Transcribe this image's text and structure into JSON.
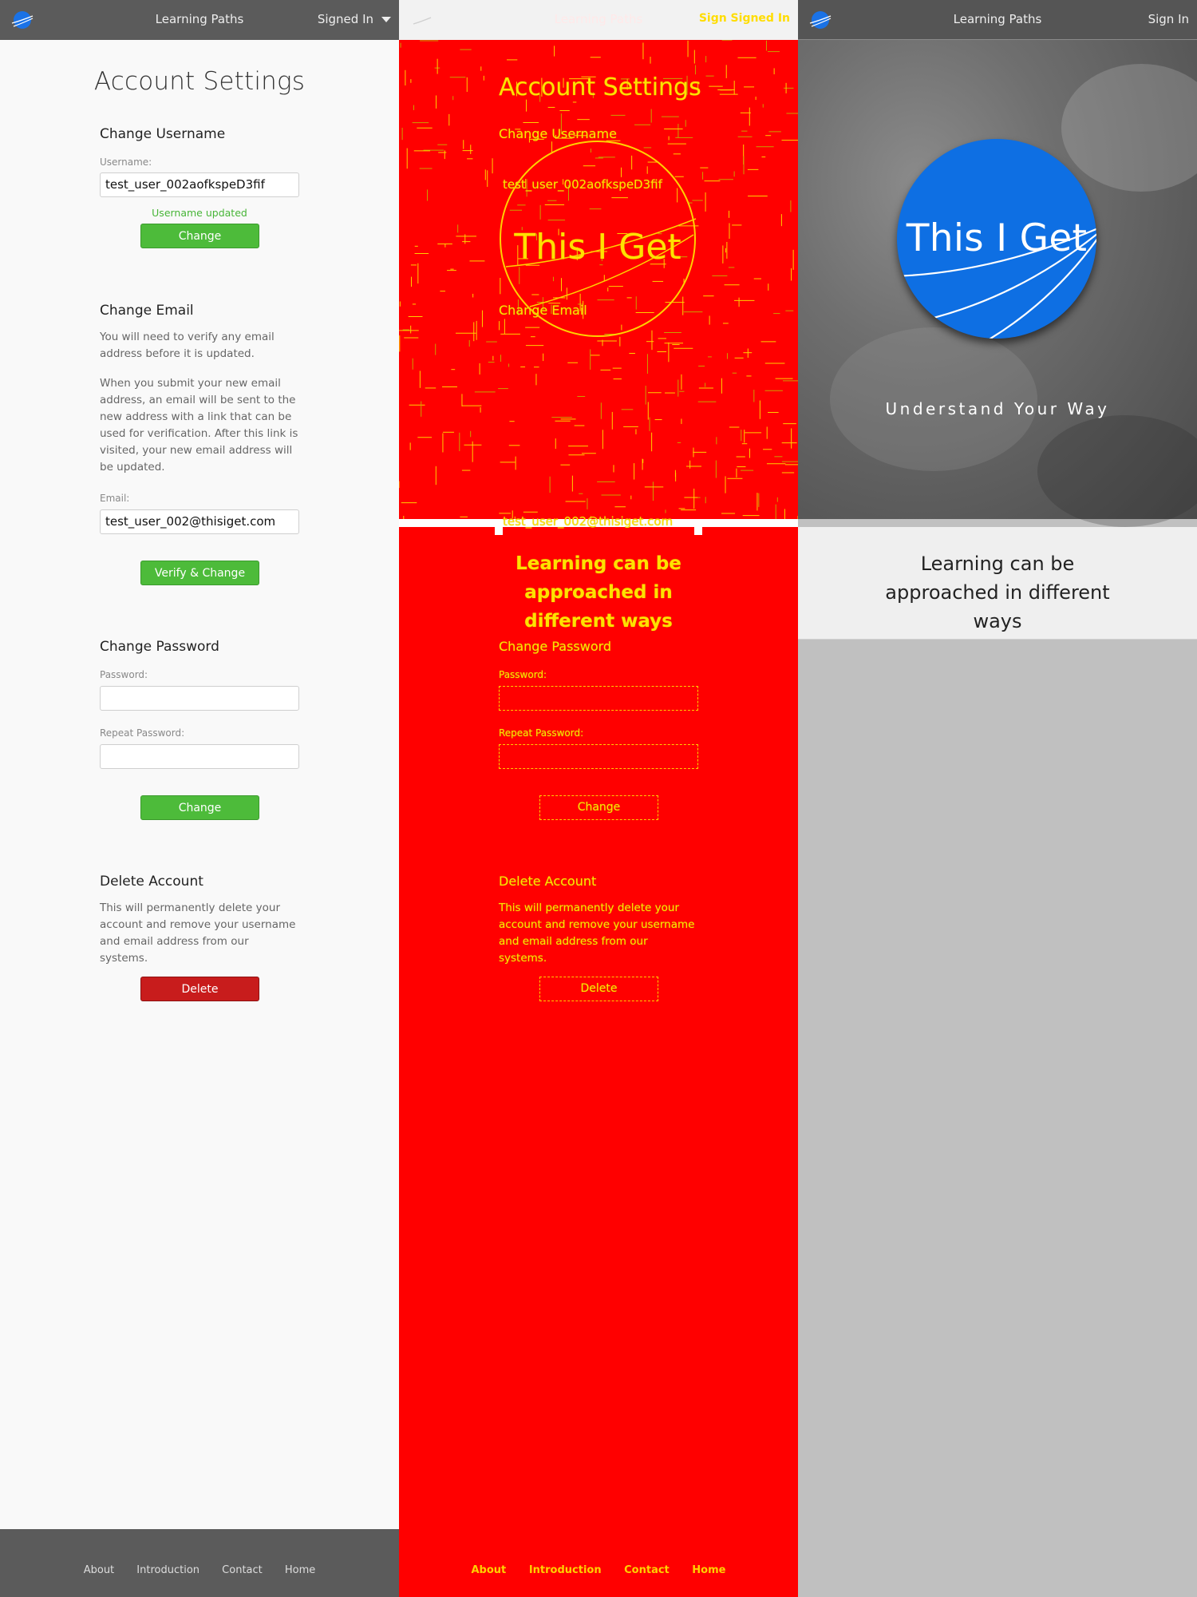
{
  "nav": {
    "paths_label": "Learning Paths",
    "signed_in_label": "Signed In",
    "sign_in_label": "Sign In",
    "overlay_right_label": "Sign Signed In"
  },
  "settings": {
    "title": "Account Settings",
    "username": {
      "heading": "Change Username",
      "label": "Username:",
      "value": "test_user_002aofkspeD3fif",
      "status": "Username updated",
      "button": "Change"
    },
    "email": {
      "heading": "Change Email",
      "para1": "You will need to verify any email address before it is updated.",
      "para2": "When you submit your new email address, an email will be sent to the new address with a link that can be used for verification. After this link is visited, your new email address will be updated.",
      "label": "Email:",
      "value": "test_user_002@thisiget.com",
      "button": "Verify & Change"
    },
    "password": {
      "heading": "Change Password",
      "label": "Password:",
      "repeat_label": "Repeat Password:",
      "button": "Change"
    },
    "delete": {
      "heading": "Delete Account",
      "para": "This will permanently delete your account and remove your username and email address from our systems.",
      "button": "Delete"
    }
  },
  "footer": {
    "links": [
      "About",
      "Introduction",
      "Contact",
      "Home"
    ]
  },
  "landing": {
    "brand": "This I Get",
    "tagline": "Understand Your Way",
    "band_text": "Learning can be approached in different ways"
  },
  "colors": {
    "nav_bg": "#5b5b5b",
    "green_button": "#4dbb3a",
    "red_button": "#c81c1c",
    "brand_blue": "#0e6fe3",
    "diff_red": "#ff0000",
    "diff_yellow": "#ffe100"
  }
}
